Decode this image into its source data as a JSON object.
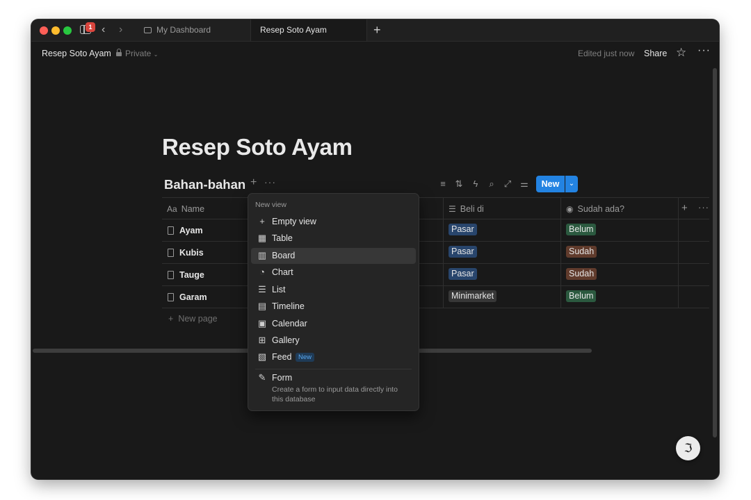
{
  "tabs": {
    "notification_count": "1",
    "items": [
      {
        "label": "My Dashboard"
      },
      {
        "label": "Resep Soto Ayam"
      }
    ]
  },
  "topbar": {
    "breadcrumb": "Resep Soto Ayam",
    "privacy": "Private",
    "edited": "Edited just now",
    "share": "Share"
  },
  "page": {
    "title": "Resep Soto Ayam"
  },
  "database": {
    "title": "Bahan-bahan",
    "new_button": "New",
    "columns": [
      {
        "label": "Name",
        "icon": "Aa"
      },
      {
        "label": "Beli di",
        "icon": "list-icon"
      },
      {
        "label": "Sudah ada?",
        "icon": "status-icon"
      }
    ],
    "rows": [
      {
        "name": "Ayam",
        "beli_di": "Pasar",
        "sudah_ada": "Belum"
      },
      {
        "name": "Kubis",
        "beli_di": "Pasar",
        "sudah_ada": "Sudah"
      },
      {
        "name": "Tauge",
        "beli_di": "Pasar",
        "sudah_ada": "Sudah"
      },
      {
        "name": "Garam",
        "beli_di": "Minimarket",
        "sudah_ada": "Belum"
      }
    ],
    "new_page": "New page"
  },
  "menu": {
    "header": "New view",
    "items": [
      {
        "label": "Empty view",
        "icon": "plus-icon"
      },
      {
        "label": "Table",
        "icon": "table-icon"
      },
      {
        "label": "Board",
        "icon": "board-icon"
      },
      {
        "label": "Chart",
        "icon": "chart-icon"
      },
      {
        "label": "List",
        "icon": "list-icon"
      },
      {
        "label": "Timeline",
        "icon": "timeline-icon"
      },
      {
        "label": "Calendar",
        "icon": "calendar-icon"
      },
      {
        "label": "Gallery",
        "icon": "gallery-icon"
      },
      {
        "label": "Feed",
        "icon": "feed-icon",
        "badge": "New"
      },
      {
        "label": "Form",
        "icon": "form-icon",
        "description": "Create a form to input data directly into this database"
      }
    ]
  },
  "colors": {
    "accent": "#2383e2",
    "chip_pasar": "#28456c",
    "chip_minimarket": "#373737",
    "chip_belum": "#2b593f",
    "chip_sudah": "#603b2c"
  }
}
